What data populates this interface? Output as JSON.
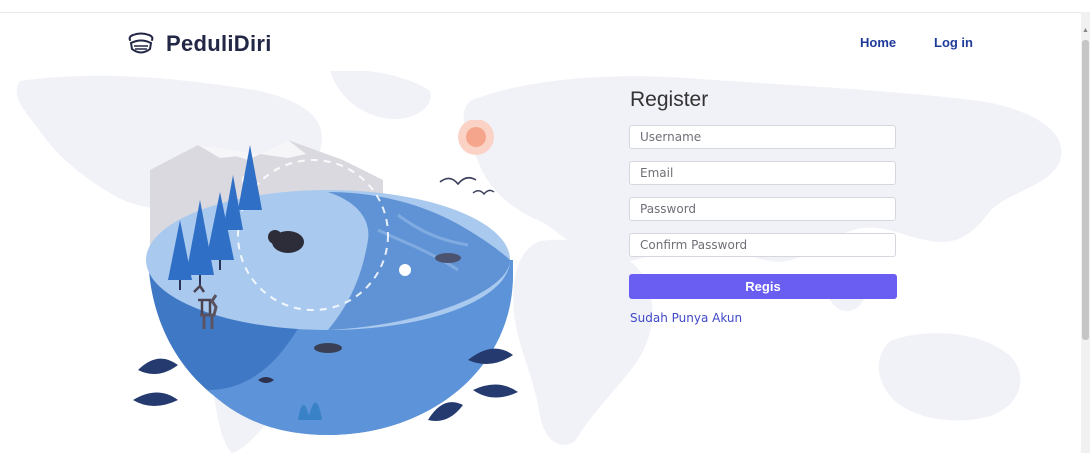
{
  "navbar": {
    "brand": "PeduliDiri",
    "links": [
      {
        "label": "Home"
      },
      {
        "label": "Log in"
      }
    ]
  },
  "register": {
    "title": "Register",
    "fields": [
      {
        "placeholder": "Username"
      },
      {
        "placeholder": "Email"
      },
      {
        "placeholder": "Password"
      },
      {
        "placeholder": "Confirm Password"
      }
    ],
    "submit_label": "Regis",
    "login_link": "Sudah Punya Akun"
  },
  "icons": [
    "mask-face-icon",
    "world-map-background",
    "globe-nature-illustration"
  ],
  "colors": {
    "brand_text": "#232746",
    "nav_link": "#1f3b9a",
    "button": "#6a5df2",
    "link": "#3f49c8",
    "map": "#f1f1f8"
  }
}
